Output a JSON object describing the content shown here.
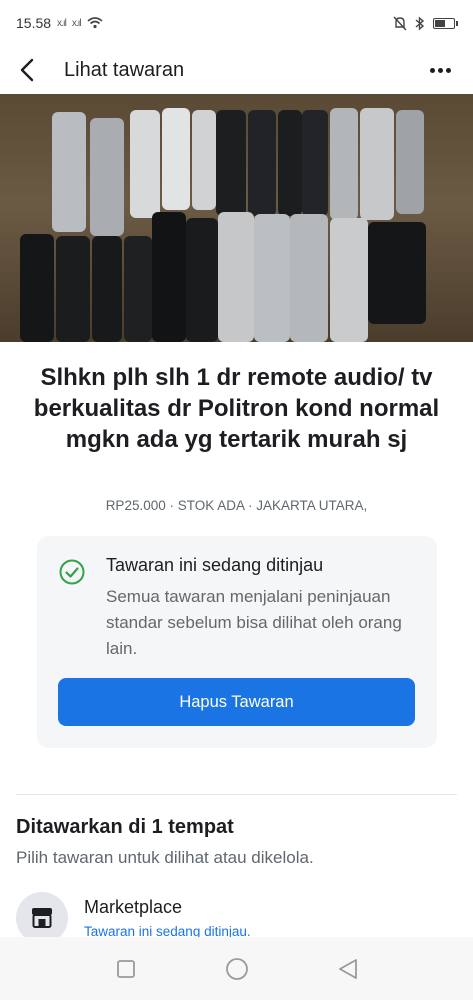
{
  "status_bar": {
    "time": "15.58",
    "signal_1": "x.ıl",
    "signal_2": "x.ıl",
    "battery_level": 0.6
  },
  "header": {
    "title": "Lihat tawaran"
  },
  "carousel": {
    "count": 6,
    "active_index": 0
  },
  "listing": {
    "title": "Slhkn plh slh 1 dr remote audio/ tv berkualitas dr Politron kond normal mgkn ada yg tertarik murah sj",
    "meta": "RP25.000 · STOK ADA · JAKARTA UTARA,"
  },
  "review": {
    "title": "Tawaran ini sedang ditinjau",
    "text": "Semua tawaran menjalani peninjauan standar sebelum bisa dilihat oleh orang lain.",
    "button_label": "Hapus Tawaran"
  },
  "offered": {
    "title": "Ditawarkan di 1 tempat",
    "subtitle": "Pilih tawaran untuk dilihat atau dikelola.",
    "places": [
      {
        "name": "Marketplace",
        "status": "Tawaran ini sedang ditinjau."
      }
    ]
  },
  "colors": {
    "accent": "#1b74e4",
    "success": "#31a24c",
    "card_bg": "#f5f6f7"
  }
}
